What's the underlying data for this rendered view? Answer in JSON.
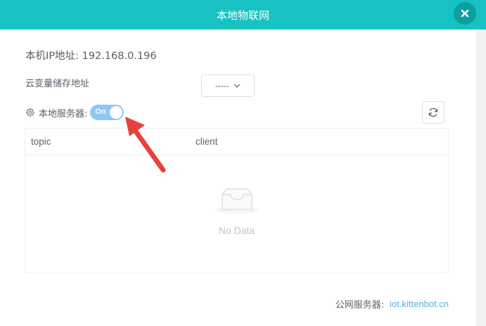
{
  "dialog": {
    "title": "本地物联网",
    "close_icon": "close-icon"
  },
  "ip": {
    "label": "本机IP地址:",
    "value": "192.168.0.196"
  },
  "storage": {
    "label": "云变量储存地址",
    "select_value": "-----"
  },
  "server": {
    "label": "本地服务器:",
    "toggle_text": "On",
    "toggle_state": true
  },
  "table": {
    "columns": [
      "topic",
      "client"
    ],
    "rows": [],
    "empty_text": "No Data"
  },
  "public_server": {
    "label": "公网服务器:",
    "link": "iot.kittenbot.cn"
  },
  "colors": {
    "header": "#17c2c2",
    "toggle_on": "#8ec7f7",
    "link": "#55b0e6",
    "annotation_arrow": "#e8413c"
  },
  "icons": [
    "close-icon",
    "gear-icon",
    "chevron-down-icon",
    "refresh-icon",
    "empty-inbox-icon",
    "annotation-arrow"
  ]
}
